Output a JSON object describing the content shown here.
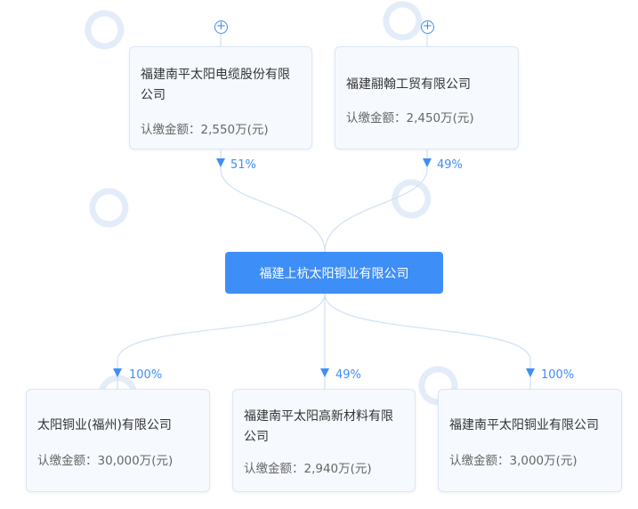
{
  "center": {
    "name": "福建上杭太阳铜业有限公司"
  },
  "shareholders": [
    {
      "name": "福建南平太阳电缆股份有限公司",
      "amount": "认缴金额：2,550万(元)",
      "percent": "51%"
    },
    {
      "name": "福建翮翰工贸有限公司",
      "amount": "认缴金额：2,450万(元)",
      "percent": "49%"
    }
  ],
  "investments": [
    {
      "name": "太阳铜业(福州)有限公司",
      "amount": "认缴金额：30,000万(元)",
      "percent": "100%"
    },
    {
      "name": "福建南平太阳高新材料有限公司",
      "amount": "认缴金额：2,940万(元)",
      "percent": "49%"
    },
    {
      "name": "福建南平太阳铜业有限公司",
      "amount": "认缴金额：3,000万(元)",
      "percent": "100%"
    }
  ],
  "icons": {
    "expand": "plus-circle-icon",
    "arrow": "arrow-down-icon",
    "watermark": "aiqicha-logo"
  },
  "colors": {
    "accent": "#3e8ef7",
    "line": "#cfe0f5",
    "card_bg": "#f6faff"
  }
}
